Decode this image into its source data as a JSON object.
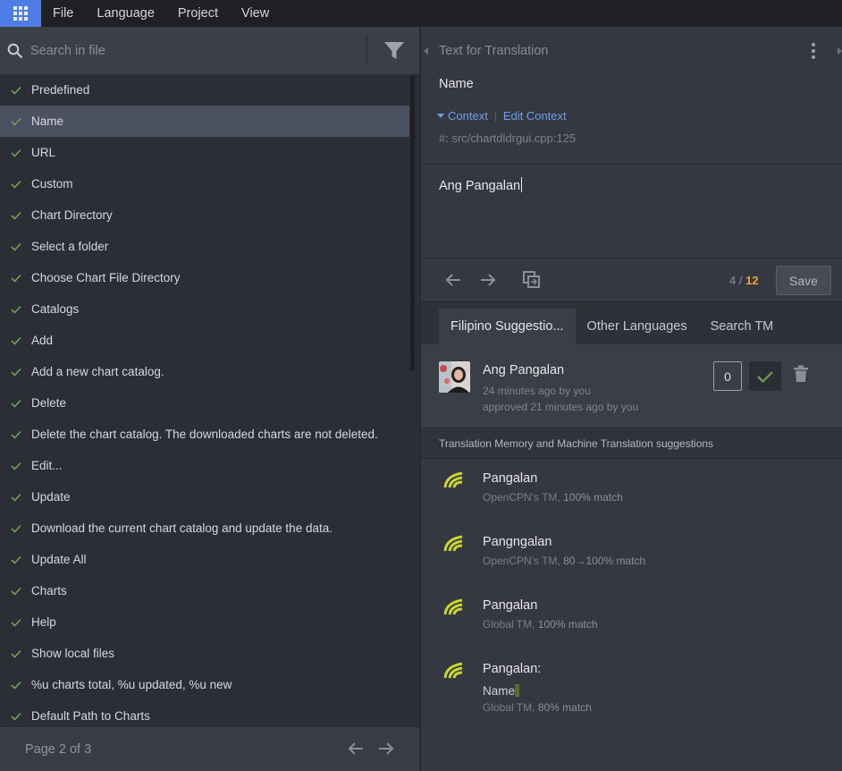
{
  "menu": {
    "apps_icon": "apps-grid-icon",
    "items": [
      "File",
      "Language",
      "Project",
      "View"
    ]
  },
  "left": {
    "search_placeholder": "Search in file",
    "entries": [
      {
        "label": "Predefined",
        "selected": false
      },
      {
        "label": "Name",
        "selected": true
      },
      {
        "label": "URL",
        "selected": false
      },
      {
        "label": "Custom",
        "selected": false
      },
      {
        "label": "Chart Directory",
        "selected": false
      },
      {
        "label": "Select a folder",
        "selected": false
      },
      {
        "label": "Choose Chart File Directory",
        "selected": false
      },
      {
        "label": "Catalogs",
        "selected": false
      },
      {
        "label": "Add",
        "selected": false
      },
      {
        "label": "Add a new chart catalog.",
        "selected": false
      },
      {
        "label": "Delete",
        "selected": false
      },
      {
        "label": "Delete the chart catalog. The downloaded charts are not deleted.",
        "selected": false
      },
      {
        "label": "Edit...",
        "selected": false
      },
      {
        "label": "Update",
        "selected": false
      },
      {
        "label": "Download the current chart catalog and update the data.",
        "selected": false
      },
      {
        "label": "Update All",
        "selected": false
      },
      {
        "label": "Charts",
        "selected": false
      },
      {
        "label": "Help",
        "selected": false
      },
      {
        "label": "Show local files",
        "selected": false
      },
      {
        "label": "%u charts total, %u updated, %u new",
        "selected": false
      },
      {
        "label": "Default Path to Charts",
        "selected": false
      }
    ],
    "pager": "Page 2 of 3"
  },
  "editor": {
    "header": "Text for Translation",
    "source_text": "Name",
    "context_label": "Context",
    "edit_context_label": "Edit Context",
    "context_ref": "#: src/chartdldrgui.cpp:125",
    "translation": "Ang Pangalan",
    "counter_current": "4 /",
    "counter_total": "12",
    "save_label": "Save"
  },
  "tabs": [
    "Filipino Suggestio...",
    "Other Languages",
    "Search TM"
  ],
  "suggestion": {
    "text": "Ang Pangalan",
    "meta1": "24 minutes ago by you",
    "meta2": "approved 21 minutes ago by you",
    "votes": "0"
  },
  "tm": {
    "header": "Translation Memory and Machine Translation suggestions",
    "items": [
      {
        "text": "Pangalan",
        "source": "OpenCPN's TM,",
        "match": "100% match"
      },
      {
        "text": "Pangngalan",
        "source": "OpenCPN's TM,",
        "match": "80→100% match"
      },
      {
        "text": "Pangalan",
        "source": "Global TM,",
        "match": "100% match"
      },
      {
        "text": "Pangalan:",
        "text2": "Name",
        "source": "Global TM,",
        "match": "80% match"
      }
    ]
  },
  "colors": {
    "accent": "#4f7de6",
    "check": "#6fa25a",
    "counter_total": "#e3a83c",
    "link": "#6f9fe8"
  }
}
